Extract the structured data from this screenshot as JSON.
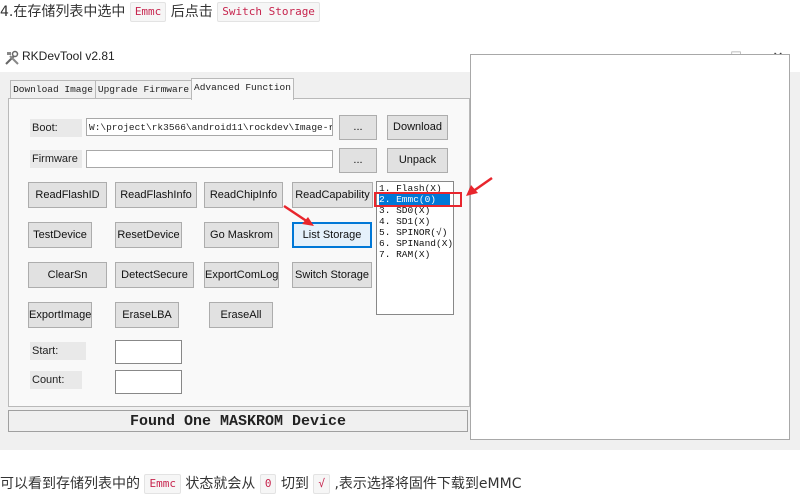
{
  "instruction": {
    "prefix": "4.在存储列表中选中",
    "tag1": "Emmc",
    "middle": "后点击",
    "tag2": "Switch Storage"
  },
  "window": {
    "title": "RKDevTool v2.81",
    "minimize": "—",
    "maximize": "☐",
    "close": "✕"
  },
  "tabs": [
    {
      "label": "Download Image",
      "active": false
    },
    {
      "label": "Upgrade Firmware",
      "active": false
    },
    {
      "label": "Advanced Function",
      "active": true
    }
  ],
  "boot": {
    "label": "Boot:",
    "path": "W:\\project\\rk3566\\android11\\rockdev\\Image-rk3",
    "browse": "...",
    "action": "Download"
  },
  "firmware": {
    "label": "Firmware",
    "path": "",
    "browse": "...",
    "action": "Unpack"
  },
  "buttons": {
    "read_flash_id": "ReadFlashID",
    "read_flash_info": "ReadFlashInfo",
    "read_chip_info": "ReadChipInfo",
    "read_capability": "ReadCapability",
    "test_device": "TestDevice",
    "reset_device": "ResetDevice",
    "go_maskrom": "Go Maskrom",
    "list_storage": "List Storage",
    "clear_sn": "ClearSn",
    "detect_secure": "DetectSecure",
    "export_com_log": "ExportComLog",
    "switch_storage": "Switch Storage",
    "export_image": "ExportImage",
    "erase_lba": "EraseLBA",
    "erase_all": "EraseAll"
  },
  "storage_list": [
    {
      "label": "1. Flash(X)",
      "selected": false
    },
    {
      "label": "2. Emmc(0)",
      "selected": true
    },
    {
      "label": "3. SD0(X)",
      "selected": false
    },
    {
      "label": "4. SD1(X)",
      "selected": false
    },
    {
      "label": "5. SPINOR(√)",
      "selected": false
    },
    {
      "label": "6. SPINand(X)",
      "selected": false
    },
    {
      "label": "7. RAM(X)",
      "selected": false
    }
  ],
  "start": {
    "label": "Start:",
    "value": ""
  },
  "count": {
    "label": "Count:",
    "value": ""
  },
  "status": "Found One MASKROM Device",
  "note": {
    "prefix": "可以看到存储列表中的",
    "tag1": "Emmc",
    "mid1": "状态就会从",
    "tag2": "0",
    "mid2": "切到",
    "tag3": "√",
    "suffix": ",表示选择将固件下载到eMMC"
  },
  "colors": {
    "accent": "#0078d7",
    "annotation": "#e8262d",
    "code": "#c7254e"
  }
}
